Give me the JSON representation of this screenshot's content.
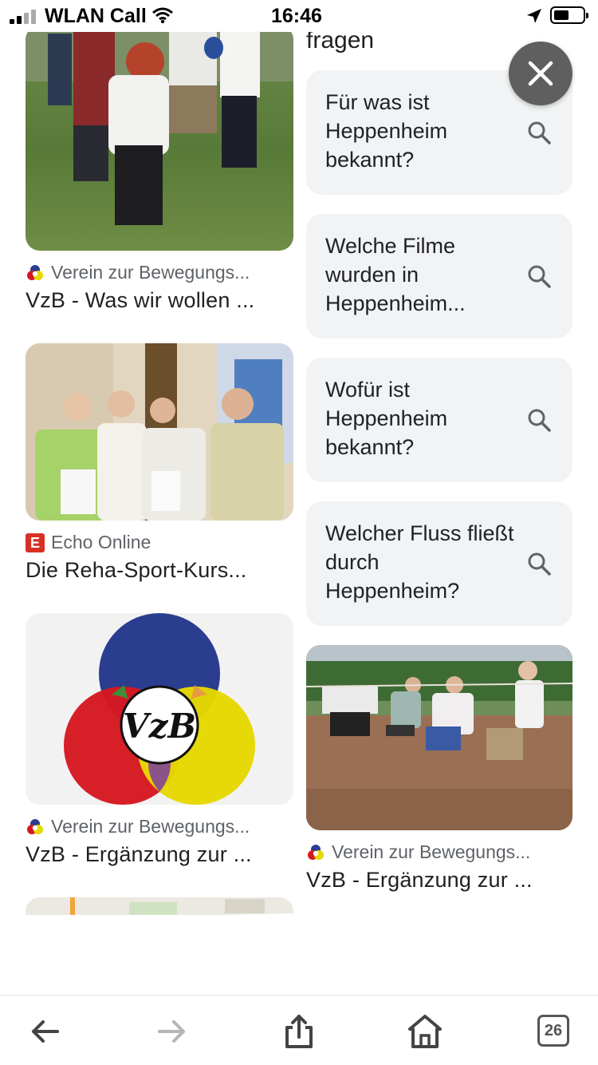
{
  "status_bar": {
    "carrier": "WLAN Call",
    "time": "16:46",
    "icons": [
      "signal-icon",
      "wifi-icon",
      "location-arrow-icon",
      "battery-icon"
    ]
  },
  "section": {
    "label": "fragen"
  },
  "left_results": [
    {
      "source": "Verein zur Bewegungs...",
      "title": "VzB - Was wir wollen ...",
      "image": "group-exercise-photo"
    },
    {
      "source": "Echo Online",
      "title": "Die Reha-Sport-Kurs...",
      "image": "seniors-certificates-photo"
    },
    {
      "source": "Verein zur Bewegungs...",
      "title": "VzB - Ergänzung zur ...",
      "image": "vzb-logo",
      "logo_text": "VzB"
    }
  ],
  "related_questions": [
    {
      "text": "Für was ist Heppenheim bekannt?"
    },
    {
      "text": "Welche Filme wurden in Heppenheim..."
    },
    {
      "text": "Wofür ist Heppenheim bekannt?"
    },
    {
      "text": "Welcher Fluss fließt durch Heppenheim?"
    }
  ],
  "right_results": [
    {
      "source": "Verein zur Bewegungs...",
      "title": "VzB - Ergänzung zur ...",
      "image": "outdoor-exercise-photo"
    }
  ],
  "toolbar": {
    "tabs_count": "26",
    "icons": [
      "back-arrow-icon",
      "forward-arrow-icon",
      "share-icon",
      "home-icon",
      "tabs-icon"
    ]
  },
  "colors": {
    "card_bg": "#f1f3f4",
    "close_button": "#5f5f5f",
    "vzb_blue": "#2b3d8f",
    "vzb_red": "#d61820",
    "vzb_yellow": "#e6d800",
    "echo_red": "#d93025"
  }
}
